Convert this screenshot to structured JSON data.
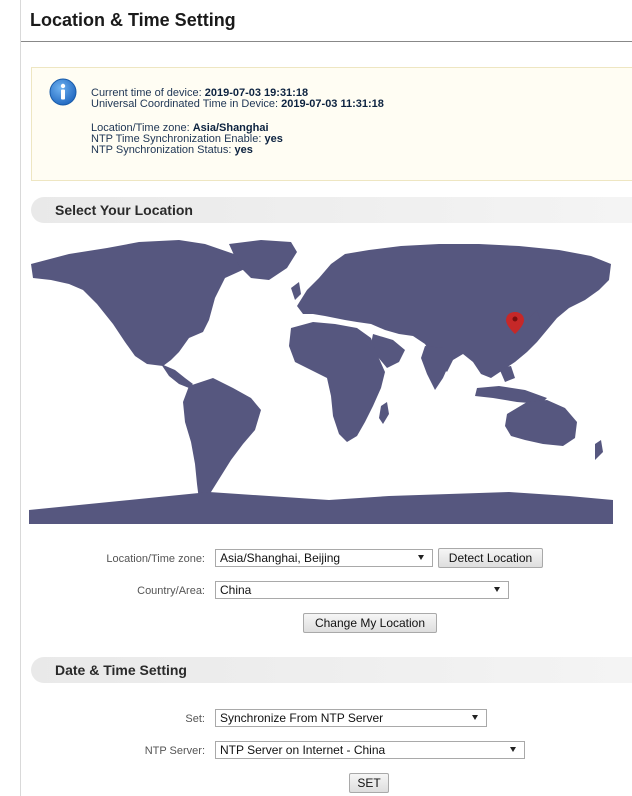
{
  "page": {
    "title": "Location & Time Setting"
  },
  "status": {
    "current_time_label": "Current time of device:",
    "current_time_value": "2019-07-03 19:31:18",
    "utc_label": "Universal Coordinated Time in Device:",
    "utc_value": "2019-07-03 11:31:18",
    "timezone_label": "Location/Time zone:",
    "timezone_value": "Asia/Shanghai",
    "ntp_enable_label": "NTP Time Synchronization Enable:",
    "ntp_enable_value": "yes",
    "ntp_status_label": "NTP Synchronization Status:",
    "ntp_status_value": "yes"
  },
  "location_section": {
    "title": "Select Your Location",
    "timezone_label": "Location/Time zone:",
    "timezone_selected": "Asia/Shanghai, Beijing",
    "detect_button": "Detect Location",
    "country_label": "Country/Area:",
    "country_selected": "China",
    "change_button": "Change My Location"
  },
  "datetime_section": {
    "title": "Date & Time Setting",
    "set_label": "Set:",
    "set_selected": "Synchronize From NTP Server",
    "ntp_label": "NTP Server:",
    "ntp_selected": "NTP Server on Internet - China",
    "set_button": "SET"
  },
  "colors": {
    "map_land": "#56577f",
    "map_ocean": "#ffffff",
    "marker": "#c62828",
    "info_icon": "#2f7fd6"
  },
  "icons": {
    "info": "info-icon",
    "marker": "location-pin-icon",
    "dropdown": "chevron-down-icon"
  }
}
